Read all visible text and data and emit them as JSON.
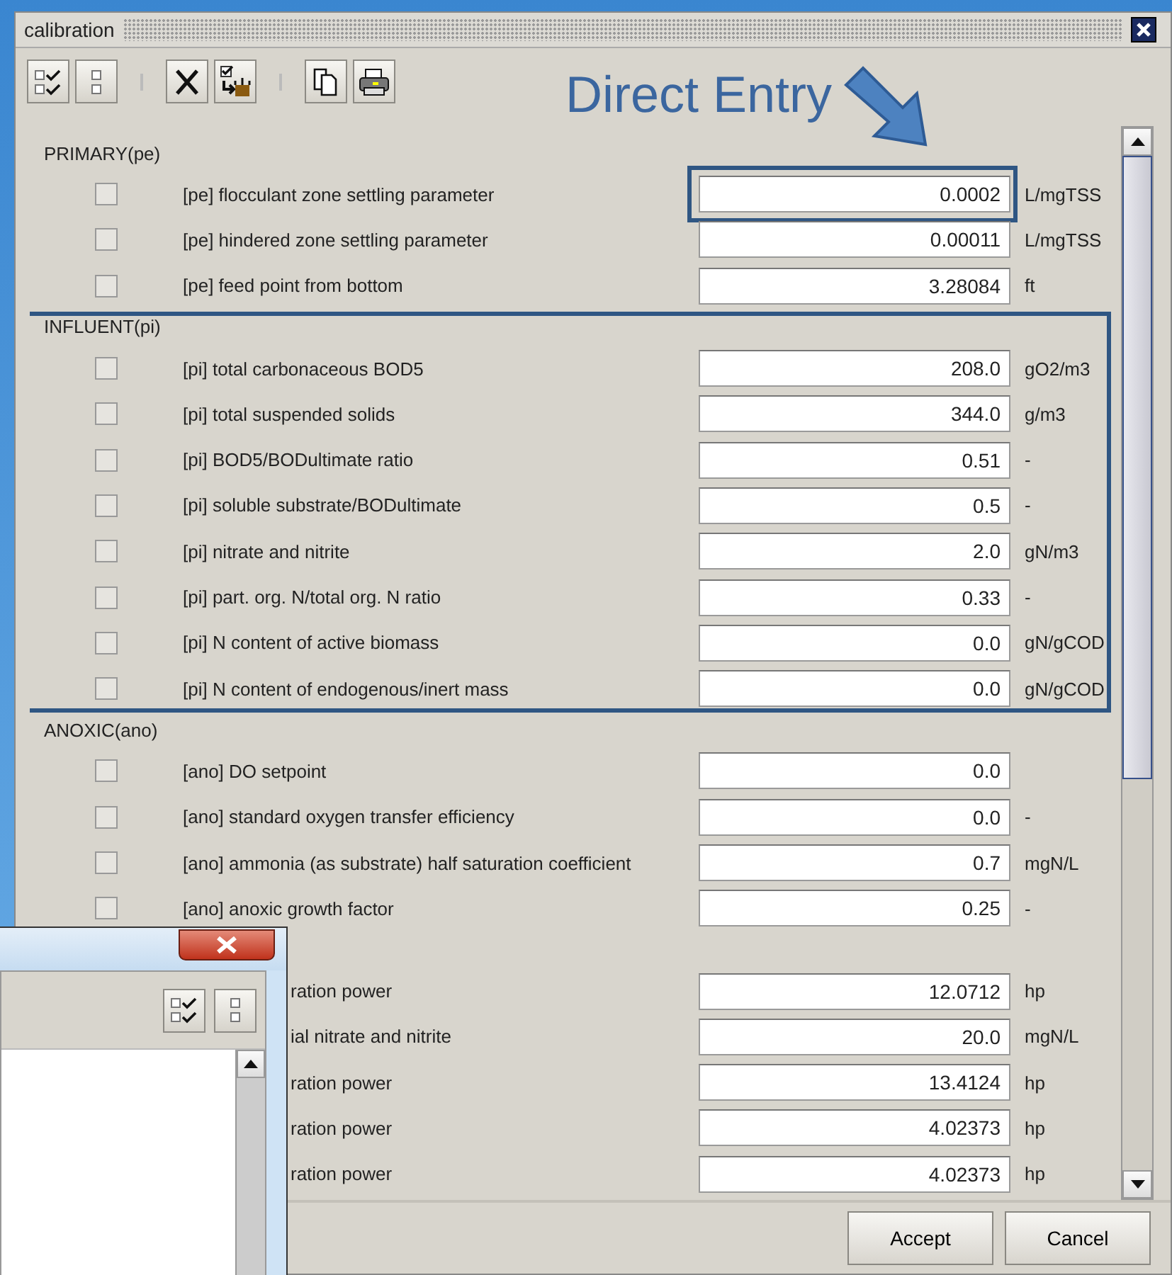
{
  "window": {
    "title": "calibration"
  },
  "annotation": {
    "text": "Direct Entry"
  },
  "sections": [
    {
      "title": "PRIMARY(pe)",
      "highlighted": false,
      "rows": [
        {
          "kind": "full",
          "checked": false,
          "highlighted": true,
          "label": "[pe] flocculant zone settling parameter",
          "value": "0.0002",
          "unit": "L/mgTSS"
        },
        {
          "kind": "full",
          "checked": false,
          "highlighted": false,
          "label": "[pe] hindered zone settling parameter",
          "value": "0.00011",
          "unit": "L/mgTSS"
        },
        {
          "kind": "full",
          "checked": false,
          "highlighted": false,
          "label": "[pe] feed point from bottom",
          "value": "3.28084",
          "unit": "ft"
        }
      ]
    },
    {
      "title": "INFLUENT(pi)",
      "highlighted": true,
      "rows": [
        {
          "kind": "full",
          "checked": false,
          "highlighted": false,
          "label": "[pi] total carbonaceous BOD5",
          "value": "208.0",
          "unit": "gO2/m3"
        },
        {
          "kind": "full",
          "checked": false,
          "highlighted": false,
          "label": "[pi] total suspended solids",
          "value": "344.0",
          "unit": "g/m3"
        },
        {
          "kind": "full",
          "checked": false,
          "highlighted": false,
          "label": "[pi] BOD5/BODultimate ratio",
          "value": "0.51",
          "unit": "-"
        },
        {
          "kind": "full",
          "checked": false,
          "highlighted": false,
          "label": "[pi] soluble substrate/BODultimate",
          "value": "0.5",
          "unit": "-"
        },
        {
          "kind": "full",
          "checked": false,
          "highlighted": false,
          "label": "[pi] nitrate and nitrite",
          "value": "2.0",
          "unit": "gN/m3"
        },
        {
          "kind": "full",
          "checked": false,
          "highlighted": false,
          "label": "[pi] part. org. N/total org. N ratio",
          "value": "0.33",
          "unit": "-"
        },
        {
          "kind": "full",
          "checked": false,
          "highlighted": false,
          "label": "[pi] N content of active biomass",
          "value": "0.0",
          "unit": "gN/gCOD"
        },
        {
          "kind": "full",
          "checked": false,
          "highlighted": false,
          "label": "[pi] N content of endogenous/inert mass",
          "value": "0.0",
          "unit": "gN/gCOD"
        }
      ]
    },
    {
      "title": "ANOXIC(ano)",
      "highlighted": false,
      "rows": [
        {
          "kind": "full",
          "checked": false,
          "highlighted": false,
          "label": "[ano] DO setpoint",
          "value": "0.0"
        },
        {
          "kind": "full",
          "checked": false,
          "highlighted": false,
          "label": "[ano] standard oxygen transfer efficiency",
          "value": "0.0",
          "unit": "-"
        },
        {
          "kind": "full",
          "checked": false,
          "highlighted": false,
          "label": "[ano] ammonia (as substrate) half saturation coefficient",
          "value": "0.7",
          "unit": "mgN/L"
        },
        {
          "kind": "full",
          "checked": false,
          "highlighted": false,
          "label": "[ano] anoxic growth factor",
          "value": "0.25",
          "unit": "-"
        }
      ]
    },
    {
      "highlighted": false,
      "rows": [
        {
          "kind": "covered",
          "highlighted": false,
          "label": "ration power",
          "value": "12.0712",
          "unit": "hp"
        },
        {
          "kind": "covered",
          "highlighted": false,
          "label": "ial nitrate and nitrite",
          "value": "20.0",
          "unit": "mgN/L"
        },
        {
          "kind": "covered",
          "highlighted": false,
          "label": "ration power",
          "value": "13.4124",
          "unit": "hp"
        },
        {
          "kind": "covered",
          "highlighted": false,
          "label": "ration power",
          "value": "4.02373",
          "unit": "hp"
        },
        {
          "kind": "covered",
          "highlighted": false,
          "label": "ration power",
          "value": "4.02373",
          "unit": "hp"
        }
      ]
    }
  ],
  "buttons": [
    "Accept",
    "Cancel"
  ]
}
